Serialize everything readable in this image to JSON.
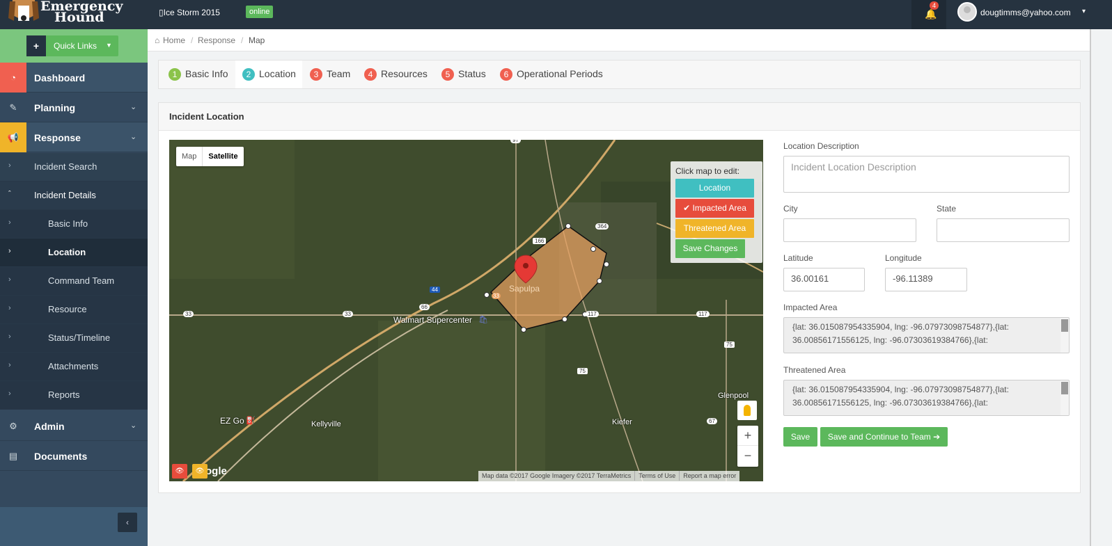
{
  "header": {
    "logo_line1": "Emergency",
    "logo_line2": "Hound",
    "incident_name": "Ice Storm 2015",
    "status": "online",
    "notification_count": "4",
    "user_email": "dougtimms@yahoo.com"
  },
  "sidebar": {
    "quick_links": "Quick Links",
    "items": [
      {
        "label": "Dashboard",
        "icon": "dashboard-icon"
      },
      {
        "label": "Planning",
        "icon": "edit-icon"
      },
      {
        "label": "Response",
        "icon": "megaphone-icon"
      },
      {
        "label": "Admin",
        "icon": "gear-icon"
      },
      {
        "label": "Documents",
        "icon": "document-icon"
      }
    ],
    "response_items": [
      "Incident Search",
      "Incident Details"
    ],
    "incident_details_items": [
      "Basic Info",
      "Location",
      "Command Team",
      "Resource",
      "Status/Timeline",
      "Attachments",
      "Reports"
    ]
  },
  "breadcrumb": [
    "Home",
    "Response",
    "Map"
  ],
  "wizard": {
    "steps": [
      {
        "num": "1",
        "label": "Basic Info",
        "color": "#8bc34a"
      },
      {
        "num": "2",
        "label": "Location",
        "color": "#40bfc1"
      },
      {
        "num": "3",
        "label": "Team",
        "color": "#f06050"
      },
      {
        "num": "4",
        "label": "Resources",
        "color": "#f06050"
      },
      {
        "num": "5",
        "label": "Status",
        "color": "#f06050"
      },
      {
        "num": "6",
        "label": "Operational Periods",
        "color": "#f06050"
      }
    ]
  },
  "panel": {
    "title": "Incident Location"
  },
  "map": {
    "type_map": "Map",
    "type_satellite": "Satellite",
    "edit_header": "Click map to edit:",
    "btn_location": "Location",
    "btn_impacted": "✔ Impacted Area",
    "btn_threatened": "Threatened Area",
    "btn_save": "Save Changes",
    "labels": {
      "sapulpa": "Sapulpa",
      "walmart": "Walmart Supercenter",
      "kellyville": "Kellyville",
      "ezgo": "EZ Go",
      "kiefer": "Kiefer",
      "glenpool": "Glenpool",
      "google": "ogle"
    },
    "shields": [
      "97",
      "166",
      "364",
      "44",
      "33",
      "66",
      "33",
      "33",
      "117",
      "117",
      "75",
      "75",
      "67"
    ],
    "footer": [
      "Map data ©2017 Google Imagery ©2017 TerraMetrics",
      "Terms of Use",
      "Report a map error"
    ],
    "colors": {
      "impacted": "#e8a060",
      "location": "#40bfc1",
      "impacted_btn": "#e74c3c",
      "threatened": "#f0b429",
      "save": "#5cb85c"
    }
  },
  "form": {
    "location_description_label": "Location Description",
    "location_description_placeholder": "Incident Location Description",
    "city_label": "City",
    "city_value": "",
    "state_label": "State",
    "state_value": "",
    "latitude_label": "Latitude",
    "latitude_value": "36.00161",
    "longitude_label": "Longitude",
    "longitude_value": "-96.11389",
    "impacted_label": "Impacted Area",
    "impacted_value": "{lat: 36.015087954335904, lng: -96.07973098754877},{lat: 36.00856171556125, lng: -96.07303619384766},{lat:",
    "threatened_label": "Threatened Area",
    "threatened_value": "{lat: 36.015087954335904, lng: -96.07973098754877},{lat: 36.00856171556125, lng: -96.07303619384766},{lat:",
    "save": "Save",
    "save_continue": "Save and Continue to Team ➔"
  }
}
